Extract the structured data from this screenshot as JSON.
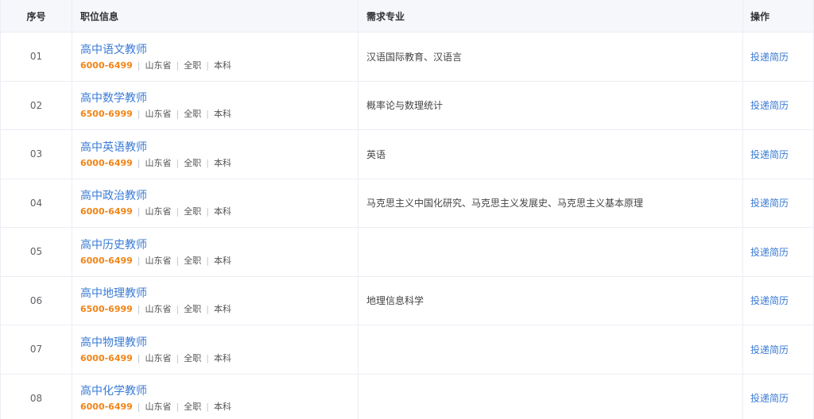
{
  "header": {
    "index": "序号",
    "job": "职位信息",
    "major": "需求专业",
    "operation": "操作"
  },
  "rows": [
    {
      "index": "01",
      "title": "高中语文教师",
      "salary": "6000-6499",
      "province": "山东省",
      "type": "全职",
      "education": "本科",
      "major": "汉语国际教育、汉语言",
      "action": "投递简历"
    },
    {
      "index": "02",
      "title": "高中数学教师",
      "salary": "6500-6999",
      "province": "山东省",
      "type": "全职",
      "education": "本科",
      "major": "概率论与数理统计",
      "action": "投递简历"
    },
    {
      "index": "03",
      "title": "高中英语教师",
      "salary": "6000-6499",
      "province": "山东省",
      "type": "全职",
      "education": "本科",
      "major": "英语",
      "action": "投递简历"
    },
    {
      "index": "04",
      "title": "高中政治教师",
      "salary": "6000-6499",
      "province": "山东省",
      "type": "全职",
      "education": "本科",
      "major": "马克思主义中国化研究、马克思主义发展史、马克思主义基本原理",
      "action": "投递简历"
    },
    {
      "index": "05",
      "title": "高中历史教师",
      "salary": "6000-6499",
      "province": "山东省",
      "type": "全职",
      "education": "本科",
      "major": "",
      "action": "投递简历"
    },
    {
      "index": "06",
      "title": "高中地理教师",
      "salary": "6500-6999",
      "province": "山东省",
      "type": "全职",
      "education": "本科",
      "major": "地理信息科学",
      "action": "投递简历"
    },
    {
      "index": "07",
      "title": "高中物理教师",
      "salary": "6000-6499",
      "province": "山东省",
      "type": "全职",
      "education": "本科",
      "major": "",
      "action": "投递简历"
    },
    {
      "index": "08",
      "title": "高中化学教师",
      "salary": "6000-6499",
      "province": "山东省",
      "type": "全职",
      "education": "本科",
      "major": "",
      "action": "投递简历"
    }
  ],
  "colors": {
    "link": "#3a7bd5",
    "salary": "#f08519",
    "header_bg": "#f5f7fa",
    "border": "#ebeef5"
  }
}
